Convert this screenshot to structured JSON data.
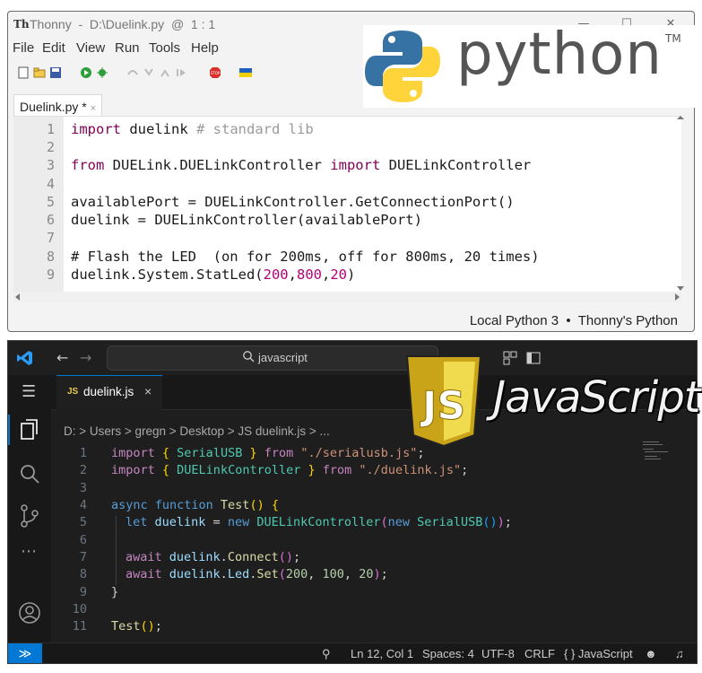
{
  "thonny": {
    "title": "Thonny  -  D:\\Duelink.py  @  1 : 1",
    "menu": [
      "File",
      "Edit",
      "View",
      "Run",
      "Tools",
      "Help"
    ],
    "tab_label": "Duelink.py *",
    "tab_close": "×",
    "line_numbers": [
      "1",
      "2",
      "3",
      "4",
      "5",
      "6",
      "7",
      "8",
      "9"
    ],
    "code": {
      "l1_kw": "import",
      "l1_rest": " duelink ",
      "l1_comment": "# standard lib",
      "l3_kw1": "from",
      "l3_mid": " DUELink.DUELinkController ",
      "l3_kw2": "import",
      "l3_rest": " DUELinkController",
      "l5": "availablePort = DUELinkController.GetConnectionPort()",
      "l6": "duelink = DUELinkController(availablePort)",
      "l8": "# Flash the LED  (on for 200ms, off for 800ms, 20 times)",
      "l9_a": "duelink.System.StatLed(",
      "l9_n1": "200",
      "l9_c1": ",",
      "l9_n2": "800",
      "l9_c2": ",",
      "l9_n3": "20",
      "l9_b": ")"
    },
    "status": "Local Python 3  •  Thonny's Python"
  },
  "python_logo": {
    "word": "python",
    "tm": "TM"
  },
  "vscode": {
    "search_text": "javascript",
    "tab_icon": "JS",
    "tab_label": "duelink.js",
    "tab_close": "×",
    "breadcrumb": "D: > Users > gregn > Desktop > JS duelink.js > ...",
    "line_numbers": [
      "1",
      "2",
      "3",
      "4",
      "5",
      "6",
      "7",
      "8",
      "9",
      "10",
      "11"
    ],
    "code": {
      "l1_import": "import",
      "l1_b1": " { ",
      "l1_cls": "SerialUSB",
      "l1_b2": " } ",
      "l1_from": "from",
      "l1_str": " \"./serialusb.js\"",
      "l1_end": ";",
      "l2_import": "import",
      "l2_b1": " { ",
      "l2_cls": "DUELinkController",
      "l2_b2": " } ",
      "l2_from": "from",
      "l2_str": " \"./duelink.js\"",
      "l2_end": ";",
      "l4_async": "async",
      "l4_fn": " function",
      "l4_name": " Test",
      "l4_p": "()",
      "l4_b": " {",
      "l5_let": "let",
      "l5_var": " duelink",
      "l5_eq": " = ",
      "l5_new": "new",
      "l5_cls": " DUELinkController",
      "l5_p1": "(",
      "l5_new2": "new",
      "l5_cls2": " SerialUSB",
      "l5_p2": "()",
      "l5_p3": ")",
      "l5_end": ";",
      "l7_await": "await",
      "l7_var": " duelink",
      "l7_dot": ".",
      "l7_fn": "Connect",
      "l7_p": "()",
      "l7_end": ";",
      "l8_await": "await",
      "l8_var": " duelink",
      "l8_dot": ".",
      "l8_led": "Led",
      "l8_dot2": ".",
      "l8_fn": "Set",
      "l8_p1": "(",
      "l8_n1": "200",
      "l8_c1": ", ",
      "l8_n2": "100",
      "l8_c2": ", ",
      "l8_n3": "20",
      "l8_p2": ")",
      "l8_end": ";",
      "l9": "}",
      "l11_fn": "Test",
      "l11_p": "()",
      "l11_end": ";"
    },
    "status": {
      "position": "Ln 12, Col 1",
      "spaces": "Spaces: 4",
      "encoding": "UTF-8",
      "eol": "CRLF",
      "language": "{ } JavaScript"
    }
  },
  "js_logo": {
    "word": "JavaScript",
    "shield": "JS"
  },
  "colors": {
    "vscode_accent": "#0078d4",
    "python_blue": "#3772a4",
    "python_yellow": "#ffd43b",
    "js_yellow": "#f0db4f"
  }
}
